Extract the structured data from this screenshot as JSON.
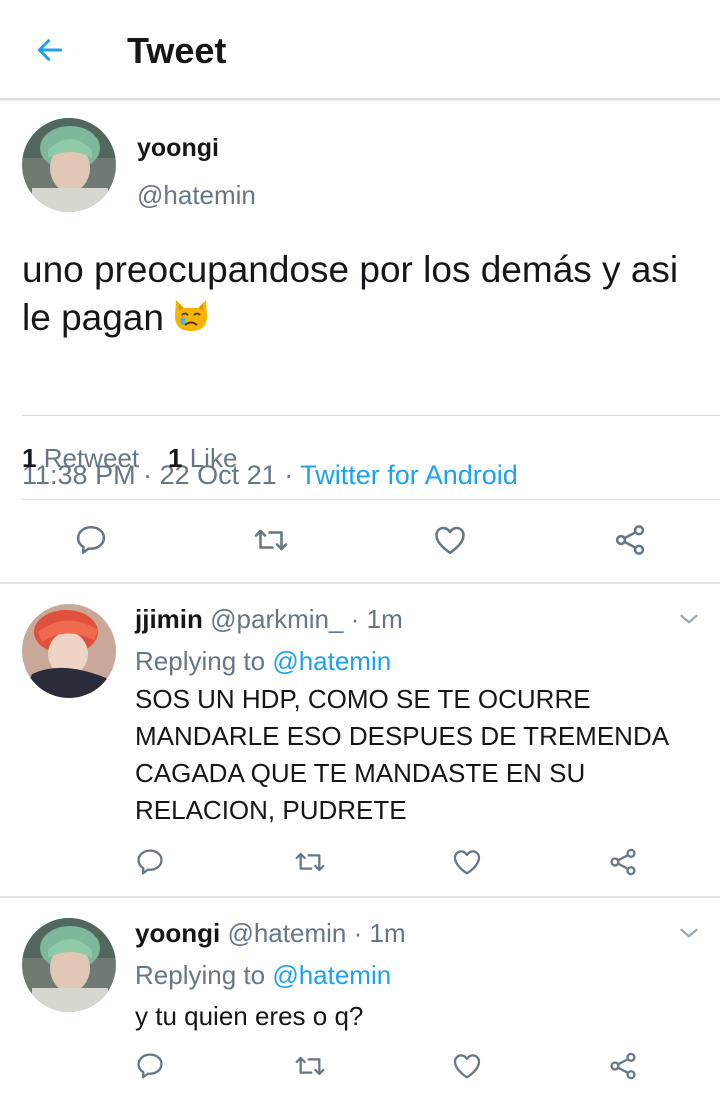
{
  "header": {
    "title": "Tweet"
  },
  "main_tweet": {
    "name": "yoongi",
    "handle": "@hatemin",
    "text": "uno preocupandose por los demás y asi le pagan",
    "time": "11:38 PM",
    "date": "22 Oct 21",
    "source": "Twitter for Android",
    "retweet_count": "1",
    "retweet_label": "Retweet",
    "like_count": "1",
    "like_label": "Like"
  },
  "replies": [
    {
      "name": "jjimin",
      "handle": "@parkmin_",
      "age": "1m",
      "replying_prefix": "Replying to",
      "replying_to": "@hatemin",
      "text": "SOS UN HDP, COMO SE TE OCURRE MANDARLE ESO DESPUES DE TREMENDA CAGADA QUE TE MANDASTE EN SU RELACION, PUDRETE"
    },
    {
      "name": "yoongi",
      "handle": "@hatemin",
      "age": "1m",
      "replying_prefix": "Replying to",
      "replying_to": "@hatemin",
      "text": "y tu quien eres o q?"
    }
  ],
  "separator": "·",
  "colors": {
    "accent": "#1da1f2",
    "secondary_text": "#657786",
    "icon": "#657786"
  }
}
